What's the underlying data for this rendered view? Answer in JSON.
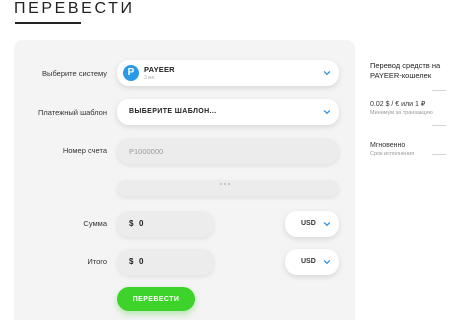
{
  "page": {
    "title": "ПЕРЕВЕСТИ"
  },
  "form": {
    "system": {
      "label": "Выберите систему",
      "value": "PAYEER",
      "sub": "3 мп.",
      "logo_letter": "P"
    },
    "template": {
      "label": "Платежный шаблон",
      "value": "ВЫБЕРИТЕ ШАБЛОН..."
    },
    "account": {
      "label": "Номер счета",
      "placeholder": "P1000000"
    },
    "amount": {
      "label": "Сумма",
      "prefix": "$",
      "value": "0",
      "currency": "USD"
    },
    "total": {
      "label": "Итого",
      "prefix": "$",
      "value": "0",
      "currency": "USD"
    },
    "submit_label": "ПЕРЕВЕСТИ"
  },
  "info": {
    "title": "Перевод средств на PAYEER-кошелек",
    "fee": "0.02 $ / € или 1 ₽",
    "fee_sub": "Минимум за транзакцию",
    "time": "Мгновенно",
    "time_sub": "Срок исполнения"
  },
  "colors": {
    "accent_green": "#3ed32a",
    "payeer_blue": "#2a9ae6",
    "chevron_blue": "#2a8fe0"
  }
}
